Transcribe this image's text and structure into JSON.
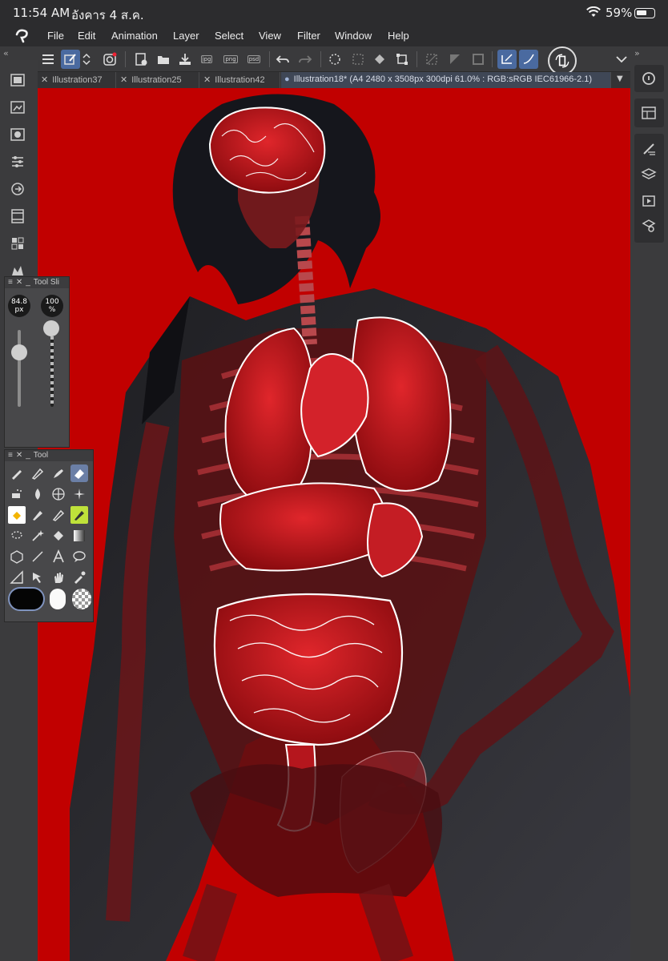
{
  "status": {
    "time": "11:54 AM",
    "date": "อังคาร 4 ส.ค.",
    "battery": "59%"
  },
  "menu": {
    "file": "File",
    "edit": "Edit",
    "animation": "Animation",
    "layer": "Layer",
    "select": "Select",
    "view": "View",
    "filter": "Filter",
    "window": "Window",
    "help": "Help"
  },
  "toolbar": {
    "jpg": "jpg",
    "png": "png",
    "psd": "psd"
  },
  "tabs": {
    "t1": "Illustration37",
    "t2": "Illustration25",
    "t3": "Illustration42",
    "active": "Illustration18* (A4 2480 x 3508px 300dpi 61.0% : RGB:sRGB IEC61966-2.1)"
  },
  "tool_slider": {
    "title": "Tool Sli",
    "size": "84.8",
    "size_unit": "px",
    "opacity": "100",
    "opacity_unit": "%"
  },
  "tool_panel": {
    "title": "Tool"
  },
  "colors": {
    "canvas": "#c10000",
    "accent": "#4a6aa0",
    "ui_dark": "#3b3b3d"
  }
}
